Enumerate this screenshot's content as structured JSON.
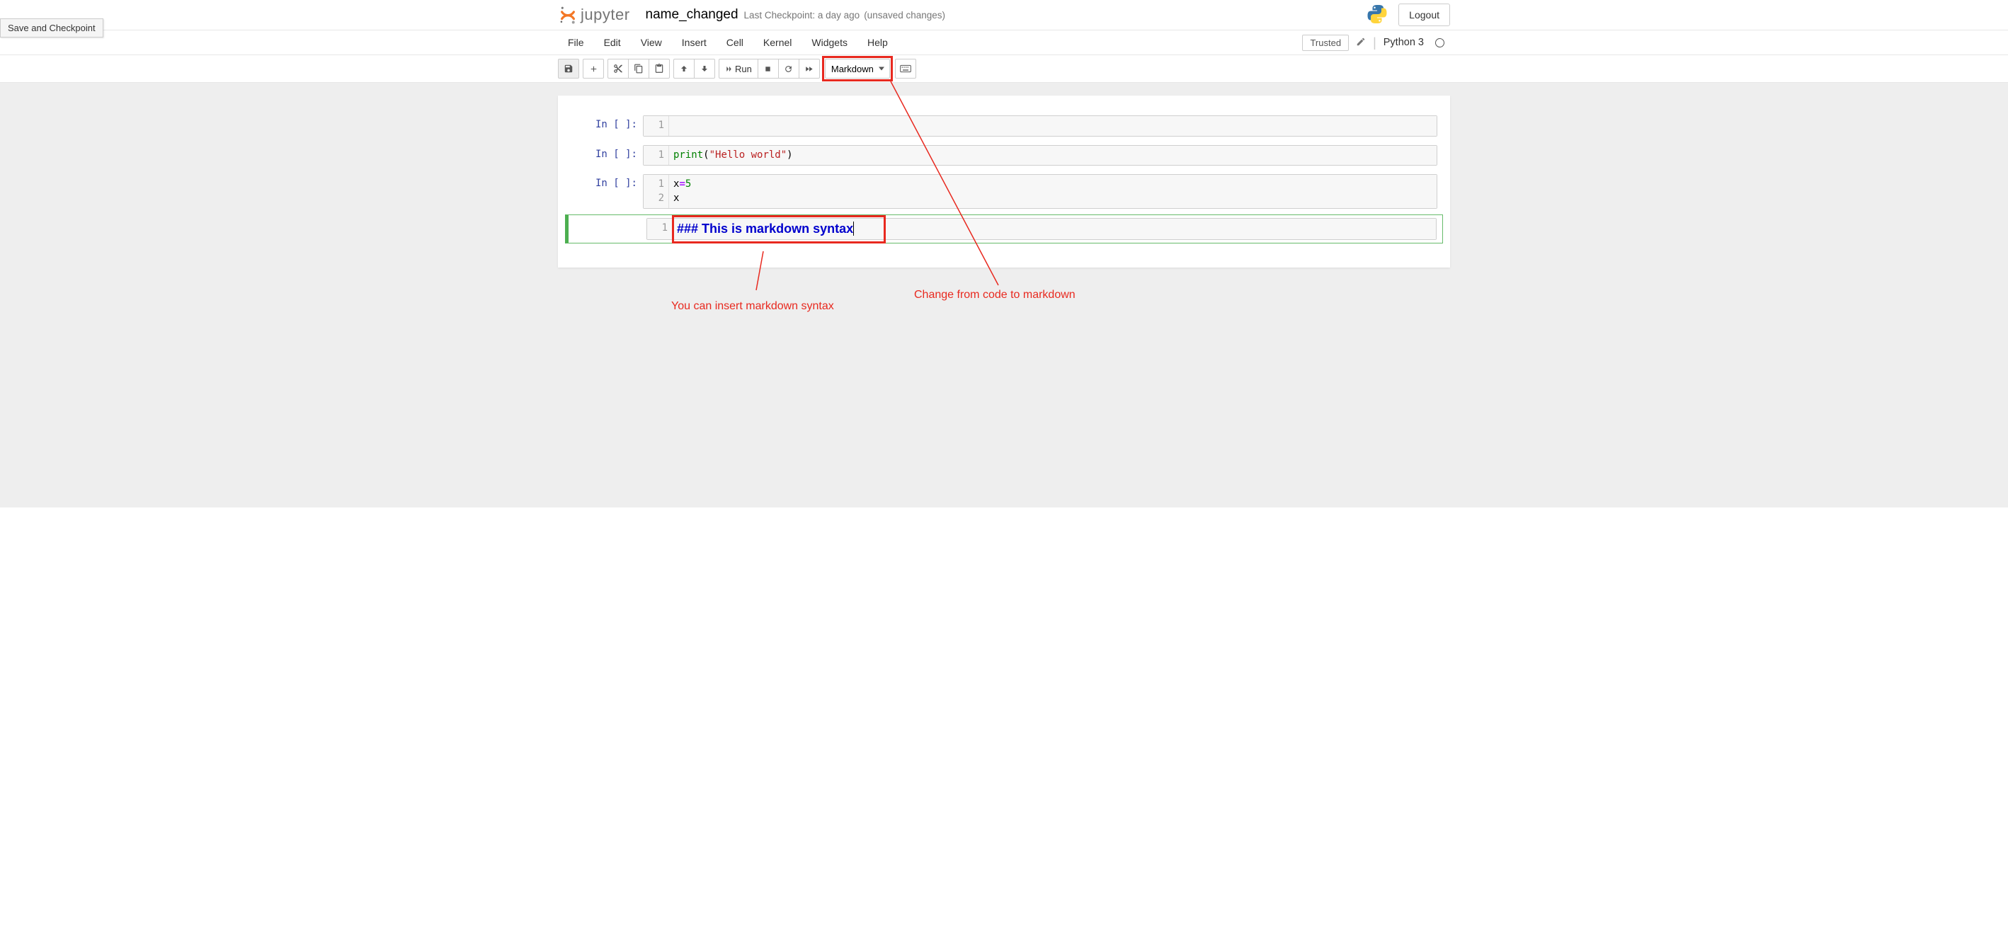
{
  "tooltip": "Save and Checkpoint",
  "brand": "jupyter",
  "notebook_name": "name_changed",
  "checkpoint_prefix": "Last Checkpoint:",
  "checkpoint_time": "a day ago",
  "unsaved": "(unsaved changes)",
  "logout": "Logout",
  "menu": {
    "file": "File",
    "edit": "Edit",
    "view": "View",
    "insert": "Insert",
    "cell": "Cell",
    "kernel": "Kernel",
    "widgets": "Widgets",
    "help": "Help"
  },
  "trusted": "Trusted",
  "kernel_name": "Python 3",
  "toolbar": {
    "run": "Run"
  },
  "cell_type_select": "Markdown",
  "cells": [
    {
      "prompt": "In [ ]:",
      "gutter": "1",
      "code_html": ""
    },
    {
      "prompt": "In [ ]:",
      "gutter": "1",
      "code_html": "<span class='cm-builtin'>print</span>(<span class='cm-string'>\"Hello world\"</span>)"
    },
    {
      "prompt": "In [ ]:",
      "gutter": "1\n2",
      "code_html": "x<span class='cm-op'>=</span><span class='cm-num'>5</span>\nx"
    },
    {
      "prompt": "",
      "gutter": "1",
      "markdown": "### This is markdown syntax"
    }
  ],
  "annotations": {
    "select_label": "Change from code to markdown",
    "markdown_label": "You can insert markdown syntax"
  }
}
